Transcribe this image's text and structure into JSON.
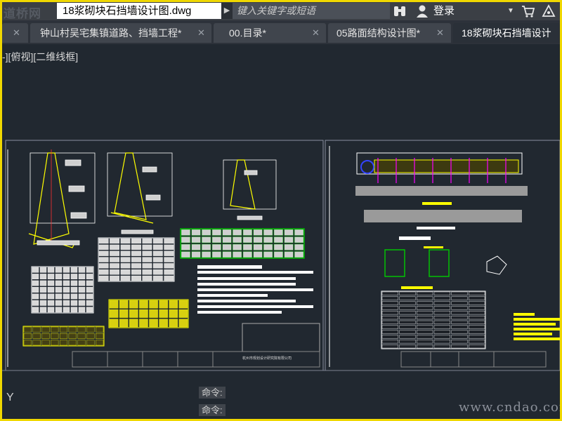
{
  "logo": {
    "text": "道桥网"
  },
  "title": {
    "filename": "18浆砌块石挡墙设计图.dwg",
    "search_placeholder": "键入关键字或短语",
    "login": "登录"
  },
  "tabs": [
    {
      "label": "钟山村吴宅集镇道路、挡墙工程*"
    },
    {
      "label": "00.目录*"
    },
    {
      "label": "05路面结构设计图*"
    },
    {
      "label": "18浆砌块石挡墙设计"
    }
  ],
  "viewport": {
    "label": "-][俯视][二维线框]"
  },
  "drawing": {
    "company_name": "杭州市规划设计研究院有限公司"
  },
  "ucs": {
    "axis": "Y"
  },
  "command_lines": [
    "命令:",
    "命令:"
  ],
  "watermark": "www.cndao.com",
  "colors": {
    "frame_border": "#f0d800",
    "background": "#212830",
    "accent_yellow": "#ffff00",
    "accent_green": "#00cc00",
    "accent_magenta": "#ff00ff"
  }
}
